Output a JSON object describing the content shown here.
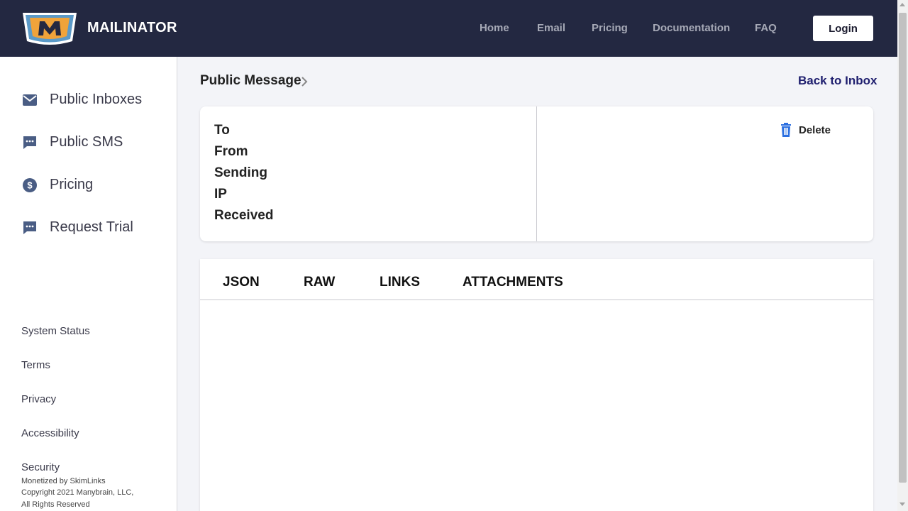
{
  "header": {
    "brand": "MAILINATOR",
    "nav": [
      "Home",
      "Email",
      "Pricing",
      "Documentation",
      "FAQ"
    ],
    "login_label": "Login",
    "logo_letter": "M",
    "colors": {
      "background": "#232841",
      "logo_orange": "#f0a33a",
      "logo_blue": "#5b9ac8"
    }
  },
  "sidebar": {
    "items": [
      {
        "label": "Public Inboxes",
        "icon": "envelope-icon"
      },
      {
        "label": "Public SMS",
        "icon": "chat-bubble-icon"
      },
      {
        "label": "Pricing",
        "icon": "dollar-circle-icon"
      },
      {
        "label": "Request Trial",
        "icon": "chat-bubble-icon"
      }
    ],
    "footer_links": [
      "System Status",
      "Terms",
      "Privacy",
      "Accessibility",
      "Security"
    ],
    "copyright": [
      "Monetized by SkimLinks",
      "Copyright 2021 Manybrain, LLC,",
      "All Rights Reserved"
    ]
  },
  "main": {
    "breadcrumb": "Public Message",
    "back_label": "Back to Inbox",
    "fields": [
      "To",
      "From",
      "Sending",
      "IP",
      "Received"
    ],
    "delete_label": "Delete",
    "tabs": [
      "JSON",
      "RAW",
      "LINKS",
      "ATTACHMENTS"
    ]
  },
  "colors": {
    "icon": "#4a5d84",
    "delete_icon": "#2b6fe0",
    "link": "#1e1e6e"
  }
}
